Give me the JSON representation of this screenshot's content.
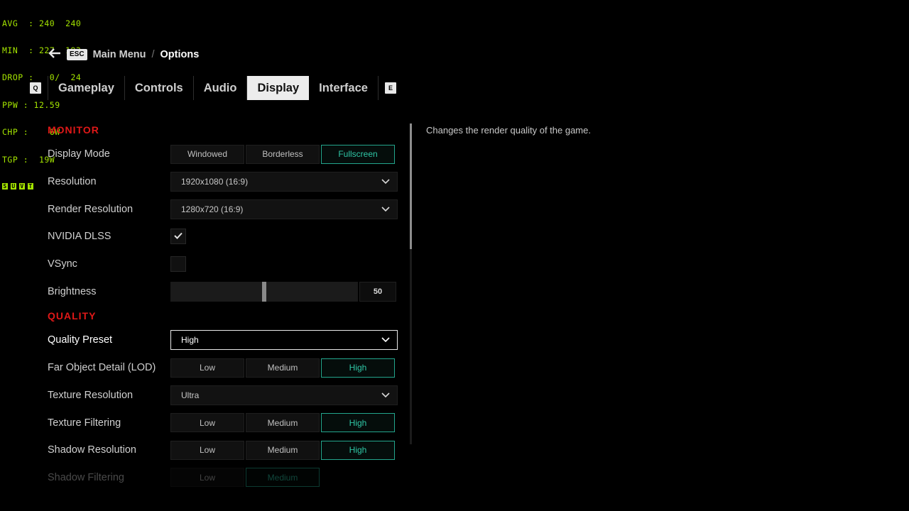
{
  "perf_overlay": {
    "lines": [
      "AVG  : 240  240",
      "MIN  : 227  193",
      "DROP :   0/  24",
      "PPW : 12.59",
      "CHP :    6W",
      "TGP :  19W"
    ],
    "keys": [
      "S",
      "U",
      "V",
      "T"
    ]
  },
  "breadcrumb": {
    "key": "ESC",
    "parent": "Main Menu",
    "separator": "/",
    "current": "Options"
  },
  "tabs": {
    "left_key": "Q",
    "right_key": "E",
    "items": [
      "Gameplay",
      "Controls",
      "Audio",
      "Display",
      "Interface"
    ],
    "active": "Display"
  },
  "monitor": {
    "title": "MONITOR",
    "display_mode": {
      "label": "Display Mode",
      "options": [
        "Windowed",
        "Borderless",
        "Fullscreen"
      ],
      "selected": "Fullscreen"
    },
    "resolution": {
      "label": "Resolution",
      "value": "1920x1080 (16:9)"
    },
    "render_resolution": {
      "label": "Render Resolution",
      "value": "1280x720 (16:9)"
    },
    "dlss": {
      "label": "NVIDIA DLSS",
      "checked": true
    },
    "vsync": {
      "label": "VSync",
      "checked": false
    },
    "brightness": {
      "label": "Brightness",
      "value": "50",
      "level": 50
    }
  },
  "quality": {
    "title": "QUALITY",
    "preset": {
      "label": "Quality Preset",
      "value": "High"
    },
    "far_object_detail": {
      "label": "Far Object Detail (LOD)",
      "options": [
        "Low",
        "Medium",
        "High"
      ],
      "selected": "High"
    },
    "texture_resolution": {
      "label": "Texture Resolution",
      "value": "Ultra"
    },
    "texture_filtering": {
      "label": "Texture Filtering",
      "options": [
        "Low",
        "Medium",
        "High"
      ],
      "selected": "High"
    },
    "shadow_resolution": {
      "label": "Shadow Resolution",
      "options": [
        "Low",
        "Medium",
        "High"
      ],
      "selected": "High"
    },
    "shadow_filtering": {
      "label": "Shadow Filtering",
      "options": [
        "Low",
        "Medium"
      ],
      "selected": "Medium"
    }
  },
  "description": "Changes the render quality of the game.",
  "colors": {
    "accent_teal": "#2fc7a6",
    "section_red": "#e01818",
    "perf_green": "#a4e400"
  },
  "scrollbar": {
    "position": 0
  }
}
